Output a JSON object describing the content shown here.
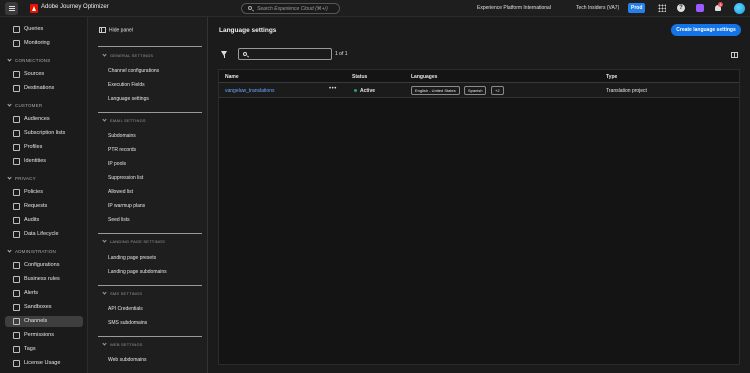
{
  "topbar": {
    "app_name": "Adobe Journey Optimizer",
    "search_placeholder": "Search Experience Cloud (⌘+/)",
    "org": "Experience Platform International",
    "sandbox": "Tech Insiders (VA7)",
    "env_badge": "Prod",
    "notification_count": "4",
    "colors": {
      "accent": "#2680eb",
      "logo": "#eb1000"
    }
  },
  "leftnav": {
    "items_top": [
      {
        "label": "Queries",
        "icon": "queries-icon"
      },
      {
        "label": "Monitoring",
        "icon": "monitoring-icon"
      }
    ],
    "sections": [
      {
        "title": "CONNECTIONS",
        "items": [
          {
            "label": "Sources",
            "icon": "sources-icon"
          },
          {
            "label": "Destinations",
            "icon": "destinations-icon"
          }
        ]
      },
      {
        "title": "CUSTOMER",
        "items": [
          {
            "label": "Audiences",
            "icon": "audiences-icon"
          },
          {
            "label": "Subscription lists",
            "icon": "subscription-lists-icon"
          },
          {
            "label": "Profiles",
            "icon": "profiles-icon"
          },
          {
            "label": "Identities",
            "icon": "identities-icon"
          }
        ]
      },
      {
        "title": "PRIVACY",
        "items": [
          {
            "label": "Policies",
            "icon": "policies-icon"
          },
          {
            "label": "Requests",
            "icon": "requests-icon"
          },
          {
            "label": "Audits",
            "icon": "audits-icon"
          },
          {
            "label": "Data Lifecycle",
            "icon": "data-lifecycle-icon"
          }
        ]
      },
      {
        "title": "ADMINISTRATION",
        "items": [
          {
            "label": "Configurations",
            "icon": "configurations-icon"
          },
          {
            "label": "Business rules",
            "icon": "business-rules-icon"
          },
          {
            "label": "Alerts",
            "icon": "alerts-icon"
          },
          {
            "label": "Sandboxes",
            "icon": "sandboxes-icon"
          },
          {
            "label": "Channels",
            "icon": "channels-icon",
            "active": true
          },
          {
            "label": "Permissions",
            "icon": "permissions-icon"
          },
          {
            "label": "Tags",
            "icon": "tags-icon"
          },
          {
            "label": "License Usage",
            "icon": "license-usage-icon"
          }
        ]
      }
    ]
  },
  "subpanel": {
    "hide_label": "Hide panel",
    "groups": [
      {
        "title": "GENERAL SETTINGS",
        "links": [
          "Channel configurations",
          "Execution Fields",
          "Language settings"
        ]
      },
      {
        "title": "EMAIL SETTINGS",
        "links": [
          "Subdomains",
          "PTR records",
          "IP pools",
          "Suppression list",
          "Allowed list",
          "IP warmup plans",
          "Seed lists"
        ]
      },
      {
        "title": "LANDING PAGE SETTINGS",
        "links": [
          "Landing page presets",
          "Landing page subdomains"
        ]
      },
      {
        "title": "SMS SETTINGS",
        "links": [
          "API Credentials",
          "SMS subdomains"
        ]
      },
      {
        "title": "WEB SETTINGS",
        "links": [
          "Web subdomains"
        ]
      }
    ]
  },
  "main": {
    "title": "Language settings",
    "create_button": "Create language settings",
    "result_count": "1 of 1",
    "columns": [
      "Name",
      "Status",
      "Languages",
      "Type"
    ],
    "rows": [
      {
        "name": "vangeluw_translations",
        "more": "•••",
        "status": "Active",
        "languages": [
          "English - United States",
          "Spanish",
          "+2"
        ],
        "type": "Translation project"
      }
    ]
  }
}
